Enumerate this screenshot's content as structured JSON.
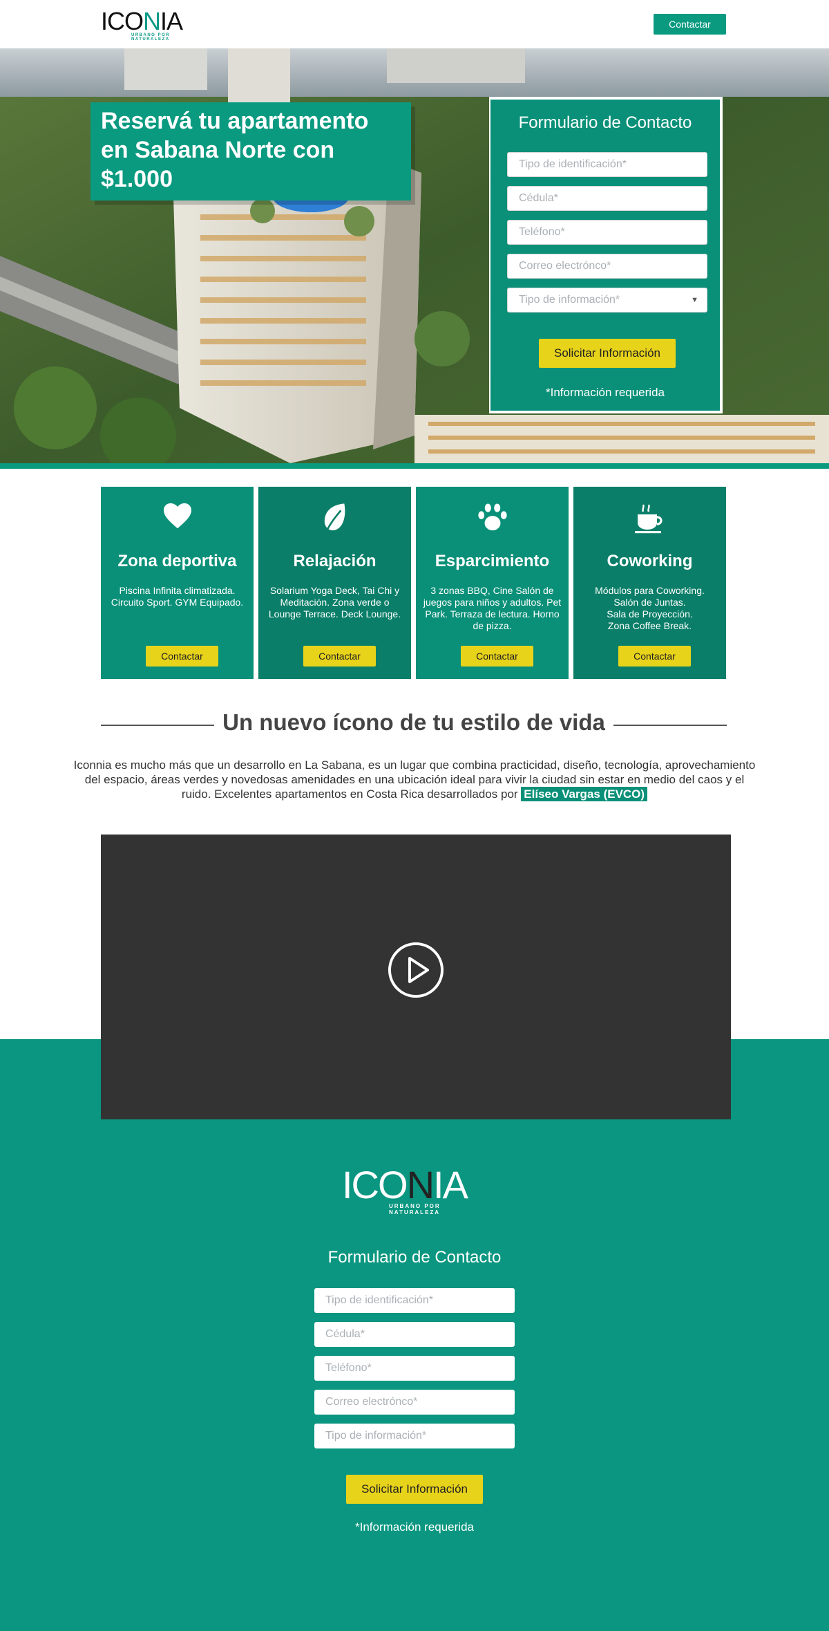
{
  "header": {
    "logo_text_a": "ICO",
    "logo_text_n": "N",
    "logo_text_b": "IA",
    "logo_tagline": "URBANO POR NATURALEZA",
    "contact_button": "Contactar"
  },
  "hero": {
    "title": "Reservá tu apartamento en Sabana Norte con $1.000"
  },
  "form": {
    "title": "Formulario de Contacto",
    "fields": [
      {
        "placeholder": "Tipo de identificación*"
      },
      {
        "placeholder": "Cédula*"
      },
      {
        "placeholder": "Teléfono*"
      },
      {
        "placeholder": "Correo electrónco*"
      },
      {
        "placeholder": "Tipo de información*"
      }
    ],
    "caret": "▼",
    "submit": "Solicitar Información",
    "required_note": "*Información requerida"
  },
  "features": [
    {
      "title": "Zona deportiva",
      "icon": "heart-icon",
      "desc": "Piscina Infinita climatizada.\nCircuito Sport. GYM Equipado.",
      "button": "Contactar"
    },
    {
      "title": "Relajación",
      "icon": "leaf-icon",
      "desc": "Solarium Yoga Deck, Tai Chi y Meditación. Zona verde o Lounge Terrace. Deck Lounge.",
      "button": "Contactar"
    },
    {
      "title": "Esparcimiento",
      "icon": "paw-icon",
      "desc": "3 zonas BBQ, Cine Salón de juegos para niños y adultos. Pet Park. Terraza de lectura. Horno de pizza.",
      "button": "Contactar"
    },
    {
      "title": "Coworking",
      "icon": "coffee-icon",
      "desc": "Módulos para Coworking.\nSalón de Juntas.\nSala de Proyección.\nZona Coffee Break.",
      "button": "Contactar"
    }
  ],
  "section": {
    "title": "Un nuevo ícono de tu estilo de vida",
    "text_1": "Iconnia es mucho más que un desarrollo en La Sabana, es un lugar que combina practicidad, diseño, tecnología, aprovechamiento del espacio, áreas verdes y novedosas amenidades en una ubicación ideal para vivir la ciudad sin estar en medio del caos y el ruido. Excelentes apartamentos en Costa Rica desarrollados por ",
    "highlight": "Elíseo Vargas (EVCO)"
  },
  "video": {
    "icon": "play-icon"
  },
  "footer": {
    "logo_text_a": "ICO",
    "logo_text_n": "N",
    "logo_text_b": "IA",
    "logo_tagline": "URBANO POR NATURALEZA",
    "form_title": "Formulario de Contacto",
    "fields": [
      {
        "placeholder": "Tipo de identificación*"
      },
      {
        "placeholder": "Cédula*"
      },
      {
        "placeholder": "Teléfono*"
      },
      {
        "placeholder": "Correo electrónco*"
      },
      {
        "placeholder": "Tipo de información*"
      }
    ],
    "submit": "Solicitar Información",
    "required_note": "*Información requerida"
  },
  "colors": {
    "brand_green": "#0a9078",
    "button_yellow": "#e8d31b",
    "video_bg": "#333333"
  }
}
